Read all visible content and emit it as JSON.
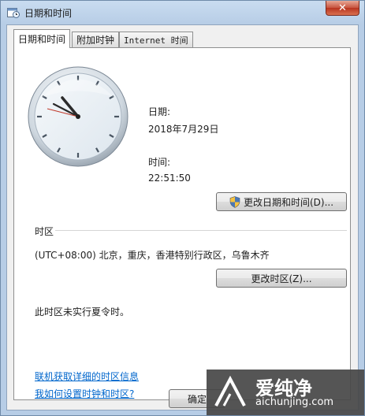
{
  "window": {
    "title": "日期和时间",
    "close_symbol": "✕"
  },
  "tabs": [
    {
      "label": "日期和时间",
      "active": true
    },
    {
      "label": "附加时钟",
      "active": false
    },
    {
      "label": "Internet 时间",
      "active": false
    }
  ],
  "date": {
    "label": "日期:",
    "value": "2018年7月29日"
  },
  "time": {
    "label": "时间:",
    "value": "22:51:50"
  },
  "change_datetime_button": "更改日期和时间(D)...",
  "timezone": {
    "section_label": "时区",
    "value": "(UTC+08:00) 北京，重庆，香港特别行政区，乌鲁木齐",
    "change_button": "更改时区(Z)...",
    "dst_note": "此时区未实行夏令时。"
  },
  "links": {
    "online_info": "联机获取详细的时区信息",
    "how_to": "我如何设置时钟和时区?"
  },
  "ok_button": "确定",
  "watermark": {
    "brand": "爱纯净",
    "url": "aichunjing.com"
  },
  "colors": {
    "link": "#0066cc",
    "close": "#c7533d"
  }
}
